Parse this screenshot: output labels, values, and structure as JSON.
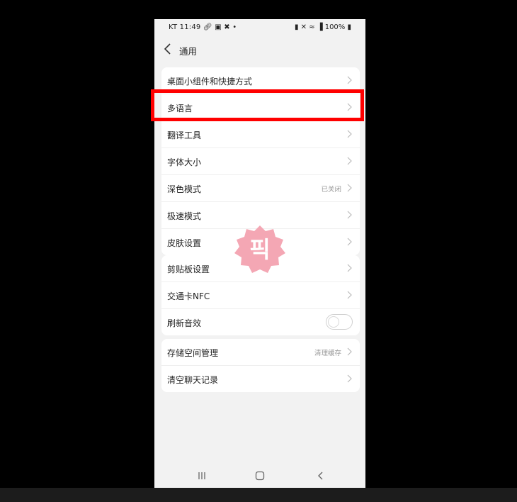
{
  "status_bar": {
    "left_text": "KT 11:49",
    "left_icons": [
      "link-icon",
      "image-icon",
      "missed-call-icon",
      "dot-icon"
    ],
    "right_icons": [
      "battery-saver-icon",
      "mute-icon",
      "wifi-icon",
      "hd-icon",
      "signal-icon"
    ],
    "battery_text": "100%"
  },
  "header": {
    "title": "通用"
  },
  "groups": [
    {
      "items": [
        {
          "label": "桌面小组件和快捷方式"
        },
        {
          "label": "多语言"
        },
        {
          "label": "翻译工具"
        },
        {
          "label": "字体大小"
        },
        {
          "label": "深色模式",
          "value": "已关闭"
        },
        {
          "label": "极速模式"
        },
        {
          "label": "皮肤设置"
        }
      ]
    },
    {
      "items": [
        {
          "label": "剪贴板设置"
        },
        {
          "label": "交通卡NFC"
        },
        {
          "label": "刷新音效",
          "toggle_on": false
        }
      ]
    },
    {
      "items": [
        {
          "label": "存储空间管理",
          "value": "清理缓存"
        },
        {
          "label": "清空聊天记录"
        }
      ]
    }
  ],
  "watermark": {
    "text": "픽",
    "color": "#f4a7b4"
  },
  "highlight_color": "#ff0000",
  "nav_icons": [
    "recent-apps-icon",
    "home-icon",
    "back-nav-icon"
  ]
}
